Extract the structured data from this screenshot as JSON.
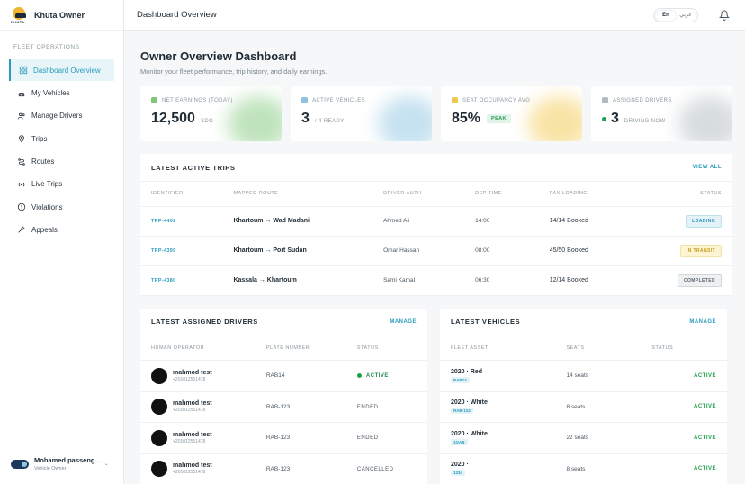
{
  "brand": {
    "name": "Khuta Owner",
    "logo_word": "KHUTA"
  },
  "sidebar": {
    "section": "FLEET OPERATIONS",
    "items": [
      {
        "label": "Dashboard Overview",
        "icon": "grid-icon",
        "active": true
      },
      {
        "label": "My Vehicles",
        "icon": "car-icon"
      },
      {
        "label": "Manage Drivers",
        "icon": "users-icon"
      },
      {
        "label": "Trips",
        "icon": "map-pin-icon"
      },
      {
        "label": "Routes",
        "icon": "route-icon"
      },
      {
        "label": "Live Trips",
        "icon": "broadcast-icon"
      },
      {
        "label": "Violations",
        "icon": "alert-circle-icon"
      },
      {
        "label": "Appeals",
        "icon": "gavel-icon"
      }
    ],
    "user": {
      "name": "Mohamed passeng...",
      "role": "Vehicle Owner"
    }
  },
  "topbar": {
    "title": "Dashboard Overview",
    "lang_en": "En",
    "lang_ar": "عربي"
  },
  "page": {
    "title": "Owner Overview Dashboard",
    "subtitle": "Monitor your fleet performance, trip history, and daily earnings."
  },
  "stats": [
    {
      "label": "NET EARNINGS (TODAY)",
      "value": "12,500",
      "unit": "SDG",
      "color": "#7fc77a"
    },
    {
      "label": "ACTIVE VEHICLES",
      "value": "3",
      "unit": "/ 4 READY",
      "color": "#8cc3e0"
    },
    {
      "label": "SEAT OCCUPANCY AVG",
      "value": "85%",
      "badge": "PEAK",
      "color": "#f2c84b"
    },
    {
      "label": "ASSIGNED DRIVERS",
      "value": "3",
      "unit": "DRIVING NOW",
      "color": "#b0bac0"
    }
  ],
  "trips": {
    "title": "LATEST ACTIVE TRIPS",
    "link": "VIEW ALL",
    "headers": [
      "IDENTIFIER",
      "MAPPED ROUTE",
      "DRIVER AUTH",
      "DEP TIME",
      "PAX LOADING",
      "STATUS"
    ],
    "rows": [
      {
        "id": "TRP-4402",
        "route": "Khartoum → Wad Madani",
        "driver": "Ahmed Ali",
        "time": "14:00",
        "pax": "14/14 Booked",
        "status": "LOADING",
        "status_class": "b-loading"
      },
      {
        "id": "TRP-4399",
        "route": "Khartoum → Port Sudan",
        "driver": "Omar Hassan",
        "time": "08:00",
        "pax": "45/50 Booked",
        "status": "IN TRANSIT",
        "status_class": "b-transit"
      },
      {
        "id": "TRP-4380",
        "route": "Kassala → Khartoum",
        "driver": "Sami Kamal",
        "time": "06:30",
        "pax": "12/14 Booked",
        "status": "COMPLETED",
        "status_class": "b-completed"
      }
    ]
  },
  "drivers": {
    "title": "LATEST ASSIGNED DRIVERS",
    "link": "MANAGE",
    "headers": [
      "HUMAN OPERATOR",
      "PLATE NUMBER",
      "STATUS"
    ],
    "rows": [
      {
        "name": "mahmod test",
        "phone": "+201012551478",
        "plate": "RAB14",
        "status": "ACTIVE"
      },
      {
        "name": "mahmod test",
        "phone": "+201012551478",
        "plate": "RAB-123",
        "status": "ENDED"
      },
      {
        "name": "mahmod test",
        "phone": "+201012551478",
        "plate": "RAB-123",
        "status": "ENDED"
      },
      {
        "name": "mahmod test",
        "phone": "+201012551478",
        "plate": "RAB-123",
        "status": "CANCELLED"
      }
    ]
  },
  "vehicles": {
    "title": "LATEST VEHICLES",
    "link": "MANAGE",
    "headers": [
      "FLEET ASSET",
      "SEATS",
      "STATUS"
    ],
    "rows": [
      {
        "name": "2020 · Red",
        "plate": "RAB14",
        "seats": "14 seats",
        "status": "ACTIVE"
      },
      {
        "name": "2020 · White",
        "plate": "RAB-123",
        "seats": "8 seats",
        "status": "ACTIVE"
      },
      {
        "name": "2020 · White",
        "plate": "1GAB",
        "seats": "22 seats",
        "status": "ACTIVE"
      },
      {
        "name": "2020 ·",
        "plate": "1234",
        "seats": "8 seats",
        "status": "ACTIVE"
      }
    ]
  }
}
